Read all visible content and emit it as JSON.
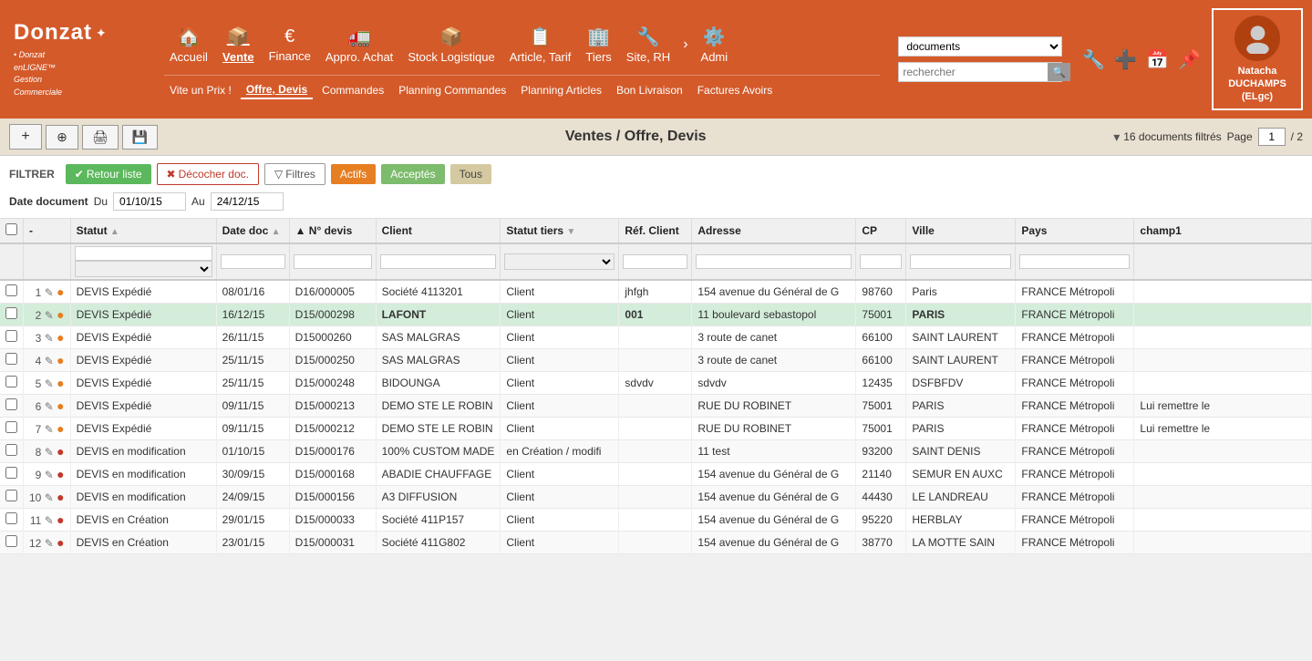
{
  "brand": {
    "name": "Donzat",
    "logo_symbol": "®",
    "subtitle": "• Donzat\nenLIGNE™\nGestion\nCommerciale"
  },
  "nav": {
    "main_items": [
      {
        "label": "Accueil",
        "icon": "🏠",
        "active": false
      },
      {
        "label": "Vente",
        "icon": "📦",
        "active": true
      },
      {
        "label": "Finance",
        "icon": "€",
        "active": false
      },
      {
        "label": "Appro. Achat",
        "icon": "🚚",
        "active": false
      },
      {
        "label": "Stock Logistique",
        "icon": "📦",
        "active": false
      },
      {
        "label": "Article, Tarif",
        "icon": "📋",
        "active": false
      },
      {
        "label": "Tiers",
        "icon": "🏢",
        "active": false
      },
      {
        "label": "Site, RH",
        "icon": "🔧",
        "active": false
      },
      {
        "label": "Admi",
        "icon": "⚙️",
        "active": false
      }
    ],
    "sub_items": [
      {
        "label": "Vite un Prix !",
        "active": false
      },
      {
        "label": "Offre, Devis",
        "active": true
      },
      {
        "label": "Commandes",
        "active": false
      },
      {
        "label": "Planning Commandes",
        "active": false
      },
      {
        "label": "Planning Articles",
        "active": false
      },
      {
        "label": "Bon Livraison",
        "active": false
      },
      {
        "label": "Factures Avoirs",
        "active": false
      }
    ]
  },
  "search": {
    "select_value": "documents",
    "placeholder": "rechercher"
  },
  "toolbar": {
    "add_label": "+",
    "btn2_label": "⊕",
    "btn3_label": "📋",
    "btn4_label": "💾",
    "page_title": "Ventes / Offre, Devis",
    "documents_filtered": "16 documents filtrés",
    "page_label": "Page",
    "page_current": "1",
    "page_total": "/ 2"
  },
  "filters": {
    "retour_liste": "Retour liste",
    "decocher_doc": "Décocher doc.",
    "filtres": "Filtres",
    "actifs": "Actifs",
    "acceptes": "Acceptés",
    "tous": "Tous",
    "filtrer_label": "FILTRER",
    "date_document": "Date document",
    "du_label": "Du",
    "du_value": "01/10/15",
    "au_label": "Au",
    "au_value": "24/12/15"
  },
  "table": {
    "columns": [
      {
        "label": "-",
        "key": "dash"
      },
      {
        "label": "Statut",
        "key": "statut"
      },
      {
        "label": "Date doc",
        "key": "date_doc"
      },
      {
        "label": "N° devis",
        "key": "num_devis"
      },
      {
        "label": "Client",
        "key": "client"
      },
      {
        "label": "Statut tiers",
        "key": "statut_tiers"
      },
      {
        "label": "Réf. Client",
        "key": "ref_client"
      },
      {
        "label": "Adresse",
        "key": "adresse"
      },
      {
        "label": "CP",
        "key": "cp"
      },
      {
        "label": "Ville",
        "key": "ville"
      },
      {
        "label": "Pays",
        "key": "pays"
      },
      {
        "label": "champ1",
        "key": "champ1"
      }
    ],
    "rows": [
      {
        "num": "1",
        "status_color": "orange",
        "statut": "DEVIS Expédié",
        "date_doc": "08/01/16",
        "num_devis": "D16/000005",
        "client": "Société 4113201",
        "statut_tiers": "Client",
        "ref_client": "jhfgh",
        "adresse": "154 avenue du Général de G",
        "cp": "98760",
        "ville": "Paris",
        "pays": "FRANCE Métropoli",
        "champ1": "",
        "highlighted": false
      },
      {
        "num": "2",
        "status_color": "orange",
        "statut": "DEVIS Expédié",
        "date_doc": "16/12/15",
        "num_devis": "D15/000298",
        "client": "LAFONT",
        "statut_tiers": "Client",
        "ref_client": "001",
        "adresse": "11 boulevard sebastopol",
        "cp": "75001",
        "ville": "PARIS",
        "pays": "FRANCE Métropoli",
        "champ1": "",
        "highlighted": true
      },
      {
        "num": "3",
        "status_color": "orange",
        "statut": "DEVIS Expédié",
        "date_doc": "26/11/15",
        "num_devis": "D15000260",
        "client": "SAS MALGRAS",
        "statut_tiers": "Client",
        "ref_client": "",
        "adresse": "3 route de canet",
        "cp": "66100",
        "ville": "SAINT LAURENT",
        "pays": "FRANCE Métropoli",
        "champ1": "",
        "highlighted": false
      },
      {
        "num": "4",
        "status_color": "orange",
        "statut": "DEVIS Expédié",
        "date_doc": "25/11/15",
        "num_devis": "D15/000250",
        "client": "SAS MALGRAS",
        "statut_tiers": "Client",
        "ref_client": "",
        "adresse": "3 route de canet",
        "cp": "66100",
        "ville": "SAINT LAURENT",
        "pays": "FRANCE Métropoli",
        "champ1": "",
        "highlighted": false
      },
      {
        "num": "5",
        "status_color": "orange",
        "statut": "DEVIS Expédié",
        "date_doc": "25/11/15",
        "num_devis": "D15/000248",
        "client": "BIDOUNGA",
        "statut_tiers": "Client",
        "ref_client": "sdvdv",
        "adresse": "sdvdv",
        "cp": "12435",
        "ville": "DSFBFDV",
        "pays": "FRANCE Métropoli",
        "champ1": "",
        "highlighted": false
      },
      {
        "num": "6",
        "status_color": "orange",
        "statut": "DEVIS Expédié",
        "date_doc": "09/11/15",
        "num_devis": "D15/000213",
        "client": "DEMO STE LE ROBIN",
        "statut_tiers": "Client",
        "ref_client": "",
        "adresse": "RUE DU ROBINET",
        "cp": "75001",
        "ville": "PARIS",
        "pays": "FRANCE Métropoli",
        "champ1": "Lui remettre le",
        "highlighted": false
      },
      {
        "num": "7",
        "status_color": "orange",
        "statut": "DEVIS Expédié",
        "date_doc": "09/11/15",
        "num_devis": "D15/000212",
        "client": "DEMO STE LE ROBIN",
        "statut_tiers": "Client",
        "ref_client": "",
        "adresse": "RUE DU ROBINET",
        "cp": "75001",
        "ville": "PARIS",
        "pays": "FRANCE Métropoli",
        "champ1": "Lui remettre le",
        "highlighted": false
      },
      {
        "num": "8",
        "status_color": "red",
        "statut": "DEVIS en modification",
        "date_doc": "01/10/15",
        "num_devis": "D15/000176",
        "client": "100% CUSTOM MADE",
        "statut_tiers": "en Création / modifi",
        "ref_client": "",
        "adresse": "11 test",
        "cp": "93200",
        "ville": "SAINT DENIS",
        "pays": "FRANCE Métropoli",
        "champ1": "",
        "highlighted": false
      },
      {
        "num": "9",
        "status_color": "red",
        "statut": "DEVIS en modification",
        "date_doc": "30/09/15",
        "num_devis": "D15/000168",
        "client": "ABADIE CHAUFFAGE",
        "statut_tiers": "Client",
        "ref_client": "",
        "adresse": "154 avenue du Général de G",
        "cp": "21140",
        "ville": "SEMUR EN AUXC",
        "pays": "FRANCE Métropoli",
        "champ1": "",
        "highlighted": false
      },
      {
        "num": "10",
        "status_color": "red",
        "statut": "DEVIS en modification",
        "date_doc": "24/09/15",
        "num_devis": "D15/000156",
        "client": "A3 DIFFUSION",
        "statut_tiers": "Client",
        "ref_client": "",
        "adresse": "154 avenue du Général de G",
        "cp": "44430",
        "ville": "LE LANDREAU",
        "pays": "FRANCE Métropoli",
        "champ1": "",
        "highlighted": false
      },
      {
        "num": "11",
        "status_color": "red",
        "statut": "DEVIS en Création",
        "date_doc": "29/01/15",
        "num_devis": "D15/000033",
        "client": "Société 411P157",
        "statut_tiers": "Client",
        "ref_client": "",
        "adresse": "154 avenue du Général de G",
        "cp": "95220",
        "ville": "HERBLAY",
        "pays": "FRANCE Métropoli",
        "champ1": "",
        "highlighted": false
      },
      {
        "num": "12",
        "status_color": "red",
        "statut": "DEVIS en Création",
        "date_doc": "23/01/15",
        "num_devis": "D15/000031",
        "client": "Société 411G802",
        "statut_tiers": "Client",
        "ref_client": "",
        "adresse": "154 avenue du Général de G",
        "cp": "38770",
        "ville": "LA MOTTE SAIN",
        "pays": "FRANCE Métropoli",
        "champ1": "",
        "highlighted": false
      }
    ]
  },
  "user": {
    "name": "Natacha\nDUCHAMPS\n(ELgc)"
  }
}
